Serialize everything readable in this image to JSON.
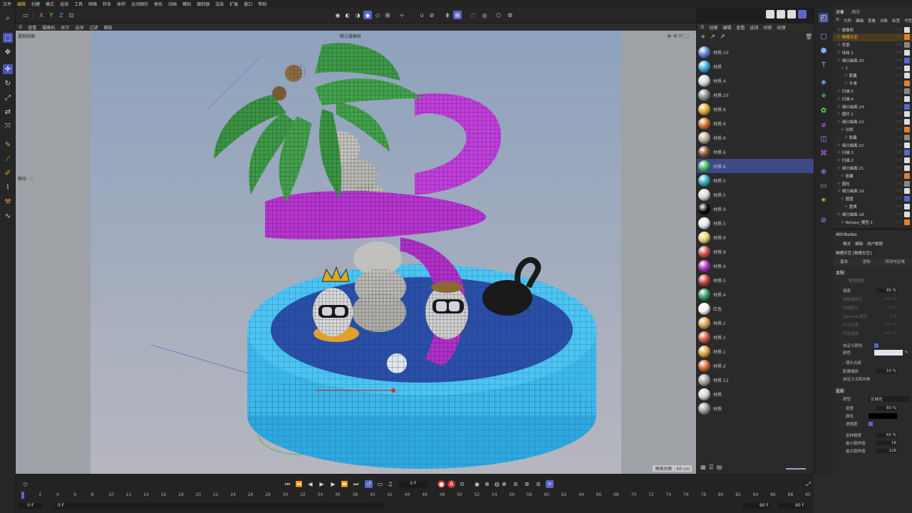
{
  "menubar": [
    "文件",
    "编辑",
    "创建",
    "模式",
    "选择",
    "工具",
    "网格",
    "样条",
    "体积",
    "运动图形",
    "角色",
    "动画",
    "模拟",
    "跟踪器",
    "渲染",
    "扩展",
    "窗口",
    "帮助"
  ],
  "viewport_menu": [
    "查看",
    "摄像机",
    "显示",
    "选项",
    "过滤",
    "面板"
  ],
  "viewport": {
    "label": "透视视图",
    "camera": "默认摄像机",
    "grid": "网格间距 : 50 cm",
    "move": "移动 ◦::"
  },
  "material_menu": [
    "创建",
    "编辑",
    "查看",
    "选择",
    "材质",
    "纹理"
  ],
  "materials": [
    {
      "name": "材质.10",
      "color": "#5a7fd0"
    },
    {
      "name": "材质",
      "color": "#38a8d8"
    },
    {
      "name": "材质.4",
      "color": "#cfd6de"
    },
    {
      "name": "材质.10",
      "color": "#8a8a8a"
    },
    {
      "name": "材质.6",
      "color": "#e0a830"
    },
    {
      "name": "材质.6",
      "color": "#d07030"
    },
    {
      "name": "材质.6",
      "color": "#b8a898"
    },
    {
      "name": "材质.6",
      "color": "#7a5038"
    },
    {
      "name": "材质.6",
      "color": "#40b060"
    },
    {
      "name": "材质.5",
      "color": "#30a8c0"
    },
    {
      "name": "材质.5",
      "color": "#d8d8d8"
    },
    {
      "name": "材质.9",
      "color": "#0a0a0a"
    },
    {
      "name": "材质.5",
      "color": "#e8e8e8"
    },
    {
      "name": "材质.9",
      "color": "#e0d070"
    },
    {
      "name": "材质.9",
      "color": "#d05050"
    },
    {
      "name": "材质.9",
      "color": "#b030c0"
    },
    {
      "name": "材质.5",
      "color": "#c84040"
    },
    {
      "name": "材质.4",
      "color": "#30a068"
    },
    {
      "name": "红色",
      "color": "#f2f2f2"
    },
    {
      "name": "材质.1",
      "color": "#d8a050"
    },
    {
      "name": "材质.1",
      "color": "#d05848"
    },
    {
      "name": "材质.1",
      "color": "#e0a040"
    },
    {
      "name": "材质.2",
      "color": "#d06828"
    },
    {
      "name": "材质.12",
      "color": "#a0a0a0"
    },
    {
      "name": "材质",
      "color": "#d0d0d0"
    },
    {
      "name": "材质",
      "color": "#9a9a9a"
    }
  ],
  "objects_tabs": [
    "对象",
    "场次"
  ],
  "objects_menu": [
    "文件",
    "编辑",
    "查看",
    "对象",
    "标签",
    "书签"
  ],
  "objects": [
    {
      "name": "摄像机",
      "indent": 0
    },
    {
      "name": "物理天空",
      "indent": 0,
      "selected": true
    },
    {
      "name": "背景",
      "indent": 0
    },
    {
      "name": "球体.1",
      "indent": 0
    },
    {
      "name": "细分曲面.20",
      "indent": 0
    },
    {
      "name": "1",
      "indent": 1
    },
    {
      "name": "胶囊",
      "indent": 2
    },
    {
      "name": "平滑",
      "indent": 2
    },
    {
      "name": "扫描.5",
      "indent": 0
    },
    {
      "name": "扫描.4",
      "indent": 0
    },
    {
      "name": "细分曲面.24",
      "indent": 0
    },
    {
      "name": "圆环.1",
      "indent": 0
    },
    {
      "name": "细分曲面.23",
      "indent": 0
    },
    {
      "name": "对称",
      "indent": 1
    },
    {
      "name": "胶囊",
      "indent": 2
    },
    {
      "name": "细分曲面.22",
      "indent": 0
    },
    {
      "name": "扫描.3",
      "indent": 0
    },
    {
      "name": "扫描.2",
      "indent": 0
    },
    {
      "name": "细分曲面.21",
      "indent": 0
    },
    {
      "name": "胶囊",
      "indent": 1
    },
    {
      "name": "圆柱",
      "indent": 0
    },
    {
      "name": "细分曲面.19",
      "indent": 0
    },
    {
      "name": "圆盘",
      "indent": 1
    },
    {
      "name": "置换",
      "indent": 2
    },
    {
      "name": "细分曲面.18",
      "indent": 0
    },
    {
      "name": "Retopo_模型.1",
      "indent": 1
    }
  ],
  "attributes": {
    "title": "Attributes",
    "menu": [
      "模式",
      "编辑",
      "用户数据"
    ],
    "object": "物理天空 [物理天空]",
    "tabs": [
      "基本",
      "坐标",
      "时间与区域"
    ],
    "section1": "太阳",
    "preset": "预览颜色",
    "rows": [
      {
        "label": "强度",
        "value": "85 %",
        "dim": false
      },
      {
        "label": "饱和度修正",
        "value": "100 %",
        "dim": true
      },
      {
        "label": "色相修正",
        "value": "0 %",
        "dim": true
      },
      {
        "label": "Gamma 修正",
        "value": "2.2",
        "dim": true
      },
      {
        "label": "尺寸比率",
        "value": "100 %",
        "dim": true
      },
      {
        "label": "可见强度",
        "value": "100 %",
        "dim": true
      }
    ],
    "custom_color": "自定义颜色",
    "color_label": "颜色",
    "lens": "› 镜头光斑",
    "distance_label": "距离缩放",
    "distance_value": "10 %",
    "custom_sun": "自定义太阳对象",
    "section2": "投影",
    "shadow_type_label": "类型",
    "shadow_type_value": "区域光",
    "shadow_rows": [
      {
        "label": "密度",
        "value": "80 %"
      },
      {
        "label": "颜色",
        "value": ""
      },
      {
        "label": "透明度",
        "value": ""
      },
      {
        "label": "采样精度",
        "value": "65 %"
      },
      {
        "label": "最小取样值",
        "value": "16"
      },
      {
        "label": "最大取样值",
        "value": "128"
      }
    ]
  },
  "timeline": {
    "frame": "0 F",
    "start": "0 F",
    "start2": "0 F",
    "end": "90 F",
    "end2": "90 F",
    "ticks": [
      "0",
      "2",
      "4",
      "6",
      "8",
      "10",
      "12",
      "14",
      "16",
      "18",
      "20",
      "22",
      "24",
      "26",
      "28",
      "30",
      "32",
      "34",
      "36",
      "38",
      "40",
      "42",
      "44",
      "46",
      "48",
      "50",
      "52",
      "54",
      "56",
      "58",
      "60",
      "62",
      "64",
      "66",
      "68",
      "70",
      "72",
      "74",
      "76",
      "78",
      "80",
      "82",
      "84",
      "86",
      "88",
      "90"
    ]
  }
}
